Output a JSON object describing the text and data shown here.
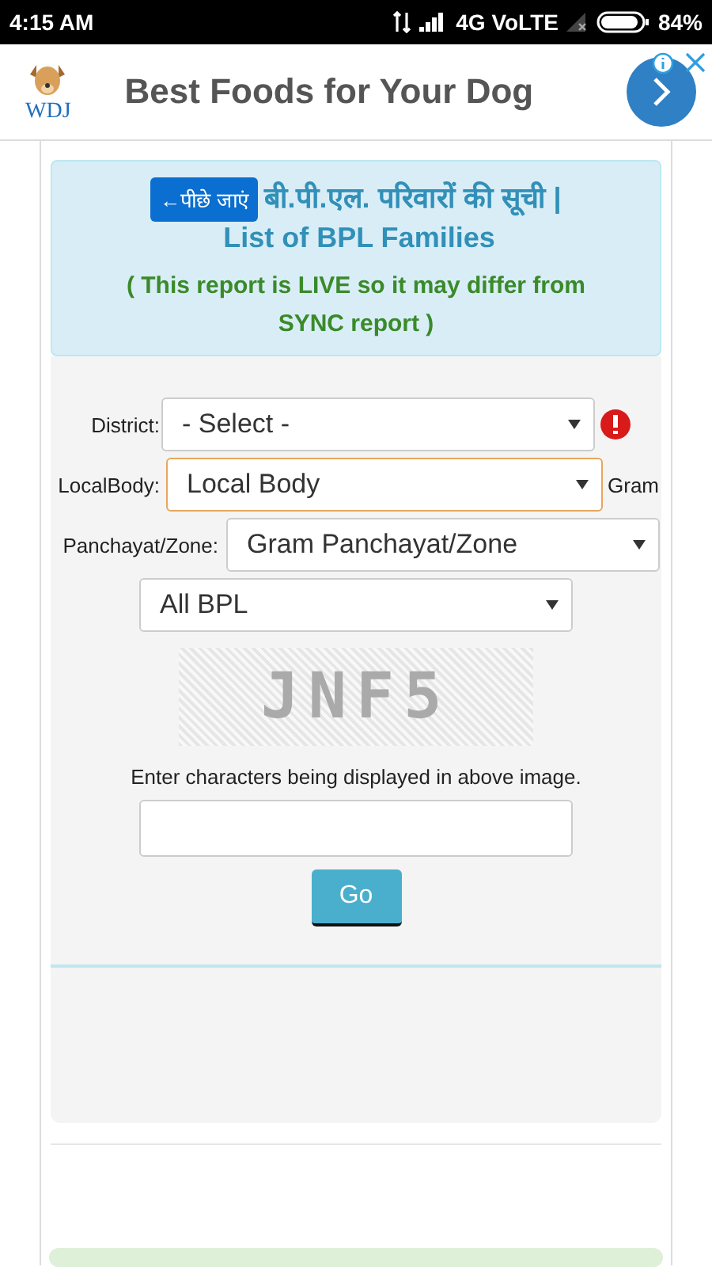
{
  "status_bar": {
    "time": "4:15 AM",
    "network": "4G VoLTE",
    "battery": "84%"
  },
  "ad": {
    "logo": "WDJ",
    "headline": "Best Foods for Your Dog"
  },
  "header": {
    "back_button": "←पीछे जाएं",
    "title_hindi": "बी.पी.एल. परिवारों की सूची |",
    "title_english": "List of BPL Families",
    "note": "( This report is LIVE so it may differ from SYNC report )"
  },
  "form": {
    "fields": [
      {
        "label": "District:",
        "value": "- Select -",
        "error": true,
        "focused": false
      },
      {
        "label": "LocalBody:",
        "value": "Local Body",
        "error": false,
        "focused": true,
        "trailing": "Gram"
      },
      {
        "label": "Panchayat/Zone:",
        "value": "Gram Panchayat/Zone",
        "error": false,
        "focused": false
      },
      {
        "value": "All BPL",
        "error": false,
        "focused": false
      }
    ],
    "captcha": "JNF5",
    "captcha_hint": "Enter characters being displayed in above image.",
    "submit": "Go"
  }
}
